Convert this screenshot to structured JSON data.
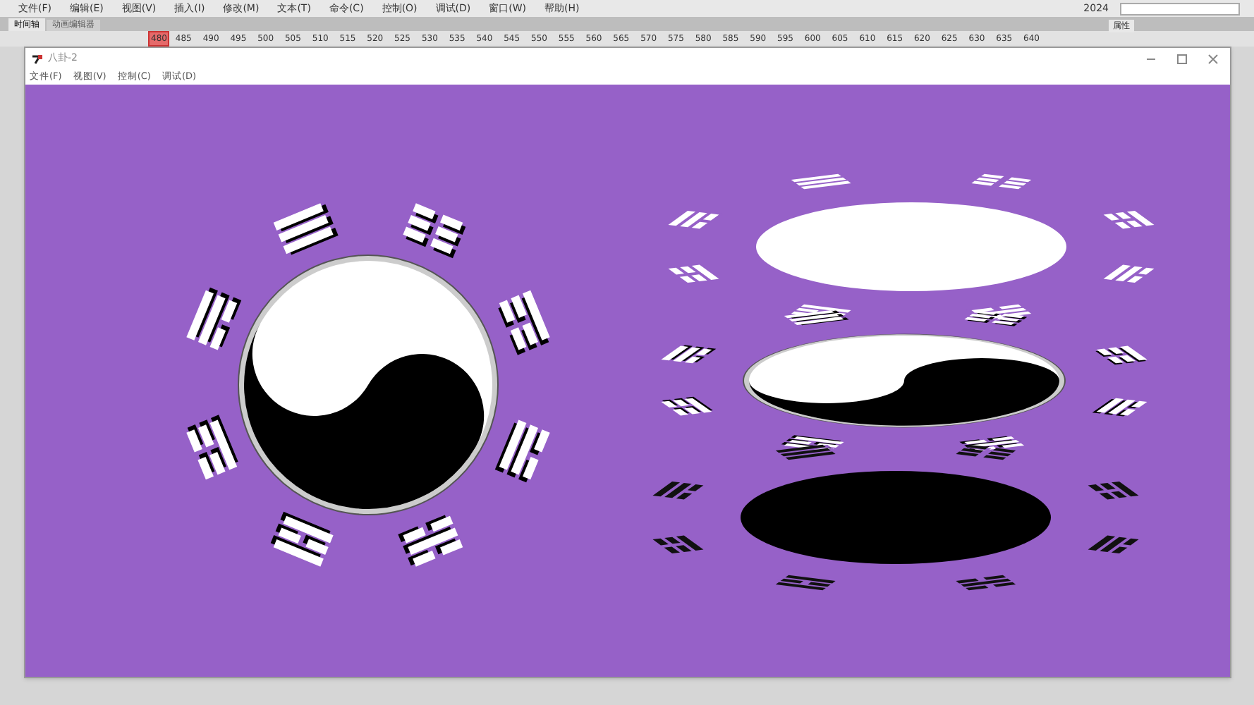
{
  "app_menu": [
    "文件(F)",
    "编辑(E)",
    "视图(V)",
    "插入(I)",
    "修改(M)",
    "文本(T)",
    "命令(C)",
    "控制(O)",
    "调试(D)",
    "窗口(W)",
    "帮助(H)"
  ],
  "workspace": "2024",
  "panel_tabs": [
    {
      "label": "时间轴",
      "selected": true
    },
    {
      "label": "动画编辑器",
      "selected": false
    }
  ],
  "ruler": {
    "current": "480",
    "ticks": [
      "485",
      "490",
      "495",
      "500",
      "505",
      "510",
      "515",
      "520",
      "525",
      "530",
      "535",
      "540",
      "545",
      "550",
      "555",
      "560",
      "565",
      "570",
      "575",
      "580",
      "585",
      "590",
      "595",
      "600",
      "605",
      "610",
      "615",
      "620",
      "625",
      "630",
      "635",
      "640"
    ]
  },
  "properties_tab": "属性",
  "player": {
    "title": "八卦-2",
    "menu": [
      "文件(F)",
      "视图(V)",
      "控制(C)",
      "调试(D)"
    ]
  }
}
